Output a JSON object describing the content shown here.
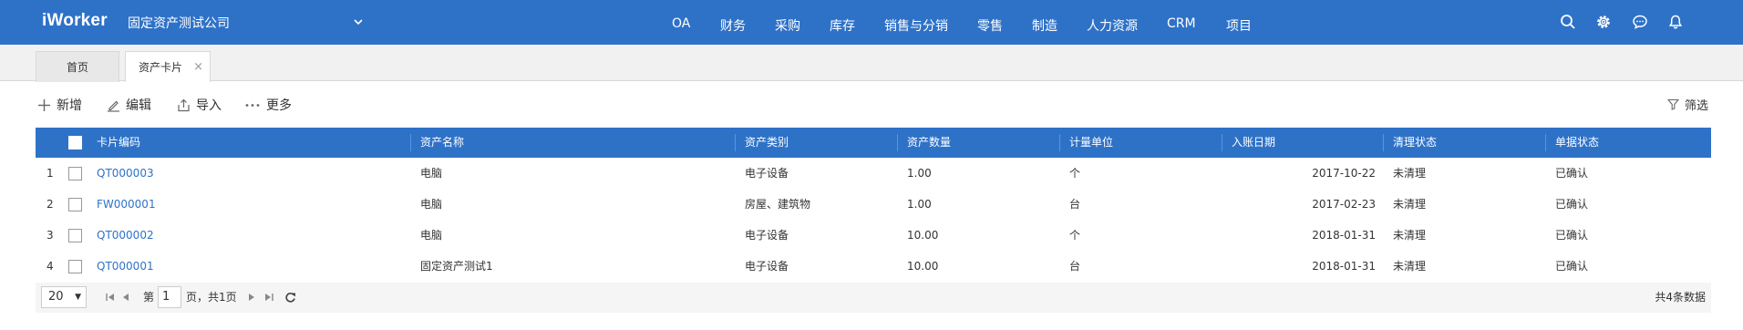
{
  "app": {
    "logo": "iWorker",
    "company": "固定资产测试公司"
  },
  "nav": [
    "OA",
    "财务",
    "采购",
    "库存",
    "销售与分销",
    "零售",
    "制造",
    "人力资源",
    "CRM",
    "项目"
  ],
  "tabs": {
    "home": "首页",
    "active": "资产卡片",
    "close": "×"
  },
  "toolbar": {
    "add": "新增",
    "edit": "编辑",
    "import": "导入",
    "more": "更多",
    "filter": "筛选"
  },
  "table": {
    "columns": [
      "卡片编码",
      "资产名称",
      "资产类别",
      "资产数量",
      "计量单位",
      "入账日期",
      "清理状态",
      "单据状态"
    ],
    "rows": [
      {
        "no": "1",
        "code": "QT000003",
        "name": "电脑",
        "category": "电子设备",
        "qty": "1.00",
        "unit": "个",
        "date": "2017-10-22",
        "clear": "未清理",
        "status": "已确认"
      },
      {
        "no": "2",
        "code": "FW000001",
        "name": "电脑",
        "category": "房屋、建筑物",
        "qty": "1.00",
        "unit": "台",
        "date": "2017-02-23",
        "clear": "未清理",
        "status": "已确认"
      },
      {
        "no": "3",
        "code": "QT000002",
        "name": "电脑",
        "category": "电子设备",
        "qty": "10.00",
        "unit": "个",
        "date": "2018-01-31",
        "clear": "未清理",
        "status": "已确认"
      },
      {
        "no": "4",
        "code": "QT000001",
        "name": "固定资产测试1",
        "category": "电子设备",
        "qty": "10.00",
        "unit": "台",
        "date": "2018-01-31",
        "clear": "未清理",
        "status": "已确认"
      }
    ]
  },
  "pager": {
    "page_size": "20",
    "page_prefix": "第",
    "page_value": "1",
    "page_suffix": "页，共1页",
    "total": "共4条数据"
  },
  "colors": {
    "primary": "#2e72c8",
    "link": "#2e72c8"
  }
}
